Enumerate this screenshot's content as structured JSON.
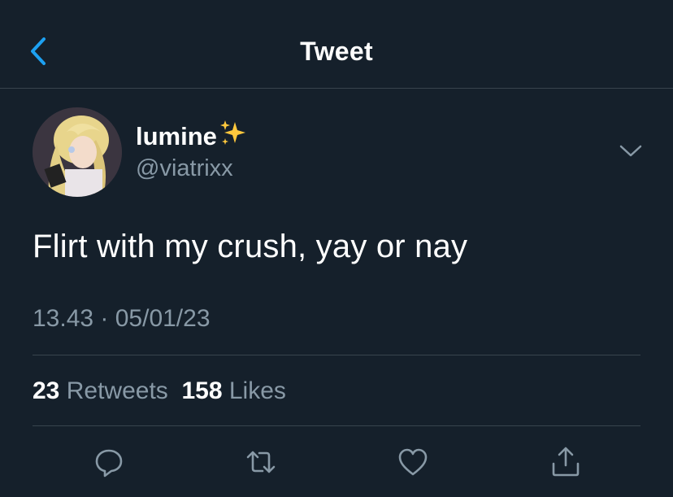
{
  "header": {
    "title": "Tweet",
    "back_icon": "chevron-left-icon",
    "accent_color": "#1da1f2"
  },
  "tweet": {
    "display_name": "lumine",
    "name_emoji": "sparkles-icon",
    "handle": "@viatrixx",
    "text": "Flirt with my crush, yay or nay",
    "timestamp": "13.43 · 05/01/23",
    "menu_icon": "chevron-down-icon"
  },
  "stats": {
    "retweets_count": "23",
    "retweets_label": "Retweets",
    "likes_count": "158",
    "likes_label": "Likes"
  },
  "actions": [
    {
      "name": "reply-icon"
    },
    {
      "name": "retweet-icon"
    },
    {
      "name": "like-icon"
    },
    {
      "name": "share-icon"
    }
  ],
  "colors": {
    "background": "#15202b",
    "secondary_text": "#8899a6",
    "divider": "#38444d"
  }
}
